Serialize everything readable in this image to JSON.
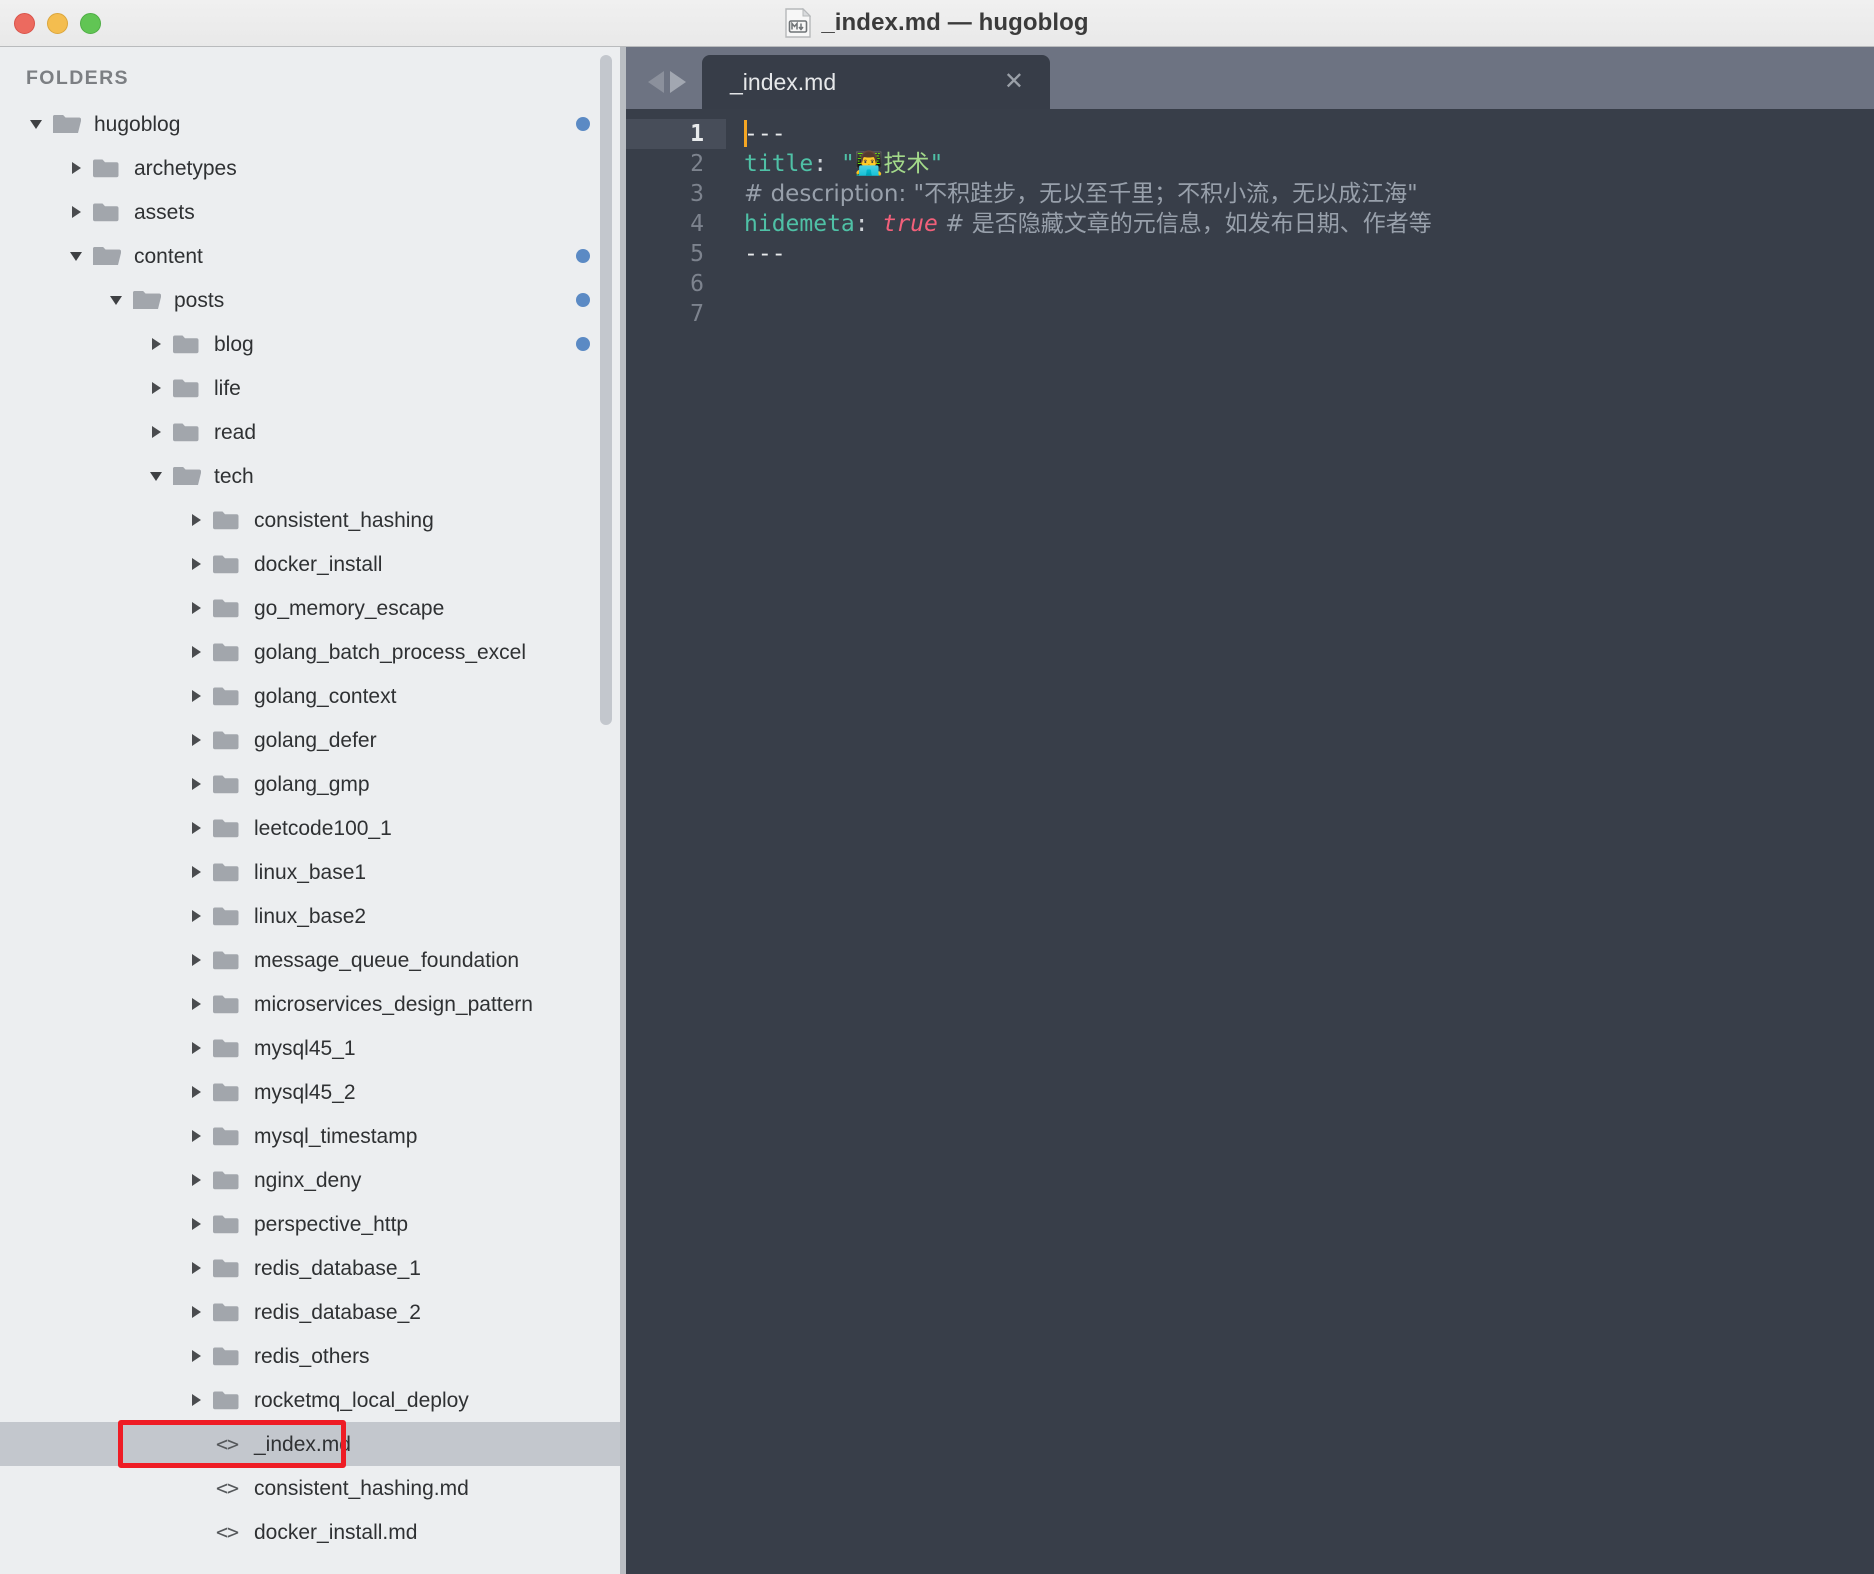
{
  "window": {
    "title": "_index.md — hugoblog",
    "file_icon": "markdown-file-icon",
    "traffic_lights": [
      "close",
      "minimize",
      "zoom"
    ]
  },
  "sidebar": {
    "heading": "FOLDERS",
    "tree": [
      {
        "label": "hugoblog",
        "type": "folder",
        "state": "open",
        "depth": 0,
        "dot": true,
        "selected": false
      },
      {
        "label": "archetypes",
        "type": "folder",
        "state": "closed",
        "depth": 1,
        "dot": false,
        "selected": false
      },
      {
        "label": "assets",
        "type": "folder",
        "state": "closed",
        "depth": 1,
        "dot": false,
        "selected": false
      },
      {
        "label": "content",
        "type": "folder",
        "state": "open",
        "depth": 1,
        "dot": true,
        "selected": false
      },
      {
        "label": "posts",
        "type": "folder",
        "state": "open",
        "depth": 2,
        "dot": true,
        "selected": false
      },
      {
        "label": "blog",
        "type": "folder",
        "state": "closed",
        "depth": 3,
        "dot": true,
        "selected": false
      },
      {
        "label": "life",
        "type": "folder",
        "state": "closed",
        "depth": 3,
        "dot": false,
        "selected": false
      },
      {
        "label": "read",
        "type": "folder",
        "state": "closed",
        "depth": 3,
        "dot": false,
        "selected": false
      },
      {
        "label": "tech",
        "type": "folder",
        "state": "open",
        "depth": 3,
        "dot": false,
        "selected": false
      },
      {
        "label": "consistent_hashing",
        "type": "folder",
        "state": "closed",
        "depth": 4,
        "dot": false,
        "selected": false
      },
      {
        "label": "docker_install",
        "type": "folder",
        "state": "closed",
        "depth": 4,
        "dot": false,
        "selected": false
      },
      {
        "label": "go_memory_escape",
        "type": "folder",
        "state": "closed",
        "depth": 4,
        "dot": false,
        "selected": false
      },
      {
        "label": "golang_batch_process_excel",
        "type": "folder",
        "state": "closed",
        "depth": 4,
        "dot": false,
        "selected": false
      },
      {
        "label": "golang_context",
        "type": "folder",
        "state": "closed",
        "depth": 4,
        "dot": false,
        "selected": false
      },
      {
        "label": "golang_defer",
        "type": "folder",
        "state": "closed",
        "depth": 4,
        "dot": false,
        "selected": false
      },
      {
        "label": "golang_gmp",
        "type": "folder",
        "state": "closed",
        "depth": 4,
        "dot": false,
        "selected": false
      },
      {
        "label": "leetcode100_1",
        "type": "folder",
        "state": "closed",
        "depth": 4,
        "dot": false,
        "selected": false
      },
      {
        "label": "linux_base1",
        "type": "folder",
        "state": "closed",
        "depth": 4,
        "dot": false,
        "selected": false
      },
      {
        "label": "linux_base2",
        "type": "folder",
        "state": "closed",
        "depth": 4,
        "dot": false,
        "selected": false
      },
      {
        "label": "message_queue_foundation",
        "type": "folder",
        "state": "closed",
        "depth": 4,
        "dot": false,
        "selected": false
      },
      {
        "label": "microservices_design_pattern",
        "type": "folder",
        "state": "closed",
        "depth": 4,
        "dot": false,
        "selected": false
      },
      {
        "label": "mysql45_1",
        "type": "folder",
        "state": "closed",
        "depth": 4,
        "dot": false,
        "selected": false
      },
      {
        "label": "mysql45_2",
        "type": "folder",
        "state": "closed",
        "depth": 4,
        "dot": false,
        "selected": false
      },
      {
        "label": "mysql_timestamp",
        "type": "folder",
        "state": "closed",
        "depth": 4,
        "dot": false,
        "selected": false
      },
      {
        "label": "nginx_deny",
        "type": "folder",
        "state": "closed",
        "depth": 4,
        "dot": false,
        "selected": false
      },
      {
        "label": "perspective_http",
        "type": "folder",
        "state": "closed",
        "depth": 4,
        "dot": false,
        "selected": false
      },
      {
        "label": "redis_database_1",
        "type": "folder",
        "state": "closed",
        "depth": 4,
        "dot": false,
        "selected": false
      },
      {
        "label": "redis_database_2",
        "type": "folder",
        "state": "closed",
        "depth": 4,
        "dot": false,
        "selected": false
      },
      {
        "label": "redis_others",
        "type": "folder",
        "state": "closed",
        "depth": 4,
        "dot": false,
        "selected": false
      },
      {
        "label": "rocketmq_local_deploy",
        "type": "folder",
        "state": "closed",
        "depth": 4,
        "dot": false,
        "selected": false
      },
      {
        "label": "_index.md",
        "type": "file",
        "state": "none",
        "depth": 4,
        "dot": false,
        "selected": true
      },
      {
        "label": "consistent_hashing.md",
        "type": "file",
        "state": "none",
        "depth": 4,
        "dot": false,
        "selected": false
      },
      {
        "label": "docker_install.md",
        "type": "file",
        "state": "none",
        "depth": 4,
        "dot": false,
        "selected": false
      }
    ],
    "annotation": {
      "color": "#ee1c25",
      "target": "_index.md"
    }
  },
  "editor": {
    "nav": {
      "prev_icon": "triangle-left-icon",
      "next_icon": "triangle-right-icon"
    },
    "tab": {
      "label": "_index.md",
      "close_icon": "close-icon",
      "active": true
    },
    "line_numbers": [
      "1",
      "2",
      "3",
      "4",
      "5",
      "6",
      "7"
    ],
    "active_line": 1,
    "lines": [
      {
        "n": 1,
        "segments": [
          {
            "t": "cursor",
            "v": ""
          },
          {
            "t": "dash",
            "v": "---"
          }
        ]
      },
      {
        "n": 2,
        "segments": [
          {
            "t": "key",
            "v": "title"
          },
          {
            "t": "punct",
            "v": ": "
          },
          {
            "t": "quote",
            "v": "\""
          },
          {
            "t": "emoji",
            "v": "👨‍💻"
          },
          {
            "t": "string",
            "v": "技术"
          },
          {
            "t": "quote",
            "v": "\""
          }
        ]
      },
      {
        "n": 3,
        "segments": [
          {
            "t": "comment",
            "v": "# description: \"不积跬步，无以至千里；不积小流，无以成江海\""
          }
        ]
      },
      {
        "n": 4,
        "segments": [
          {
            "t": "key",
            "v": "hidemeta"
          },
          {
            "t": "punct",
            "v": ": "
          },
          {
            "t": "bool",
            "v": "true"
          },
          {
            "t": "comment",
            "v": " # 是否隐藏文章的元信息，如发布日期、作者等"
          }
        ]
      },
      {
        "n": 5,
        "segments": [
          {
            "t": "dash",
            "v": "---"
          }
        ]
      },
      {
        "n": 6,
        "segments": []
      },
      {
        "n": 7,
        "segments": []
      }
    ]
  },
  "colors": {
    "titlebar_bg": "#eeeeee",
    "sidebar_bg": "#eceef0",
    "selection_bg": "#c3c7cd",
    "editor_bg": "#383e49",
    "tabbar_bg": "#6d7382",
    "tab_active_bg": "#373d48",
    "active_line_bg": "#474d59",
    "modified_dot": "#5b8ac4",
    "cursor": "#f5a623",
    "annotation_red": "#ee1c25",
    "key_teal": "#4fc1a6",
    "string_green": "#a3d98a",
    "comment_gray": "#98a0ab",
    "bool_pink": "#f2607a"
  }
}
